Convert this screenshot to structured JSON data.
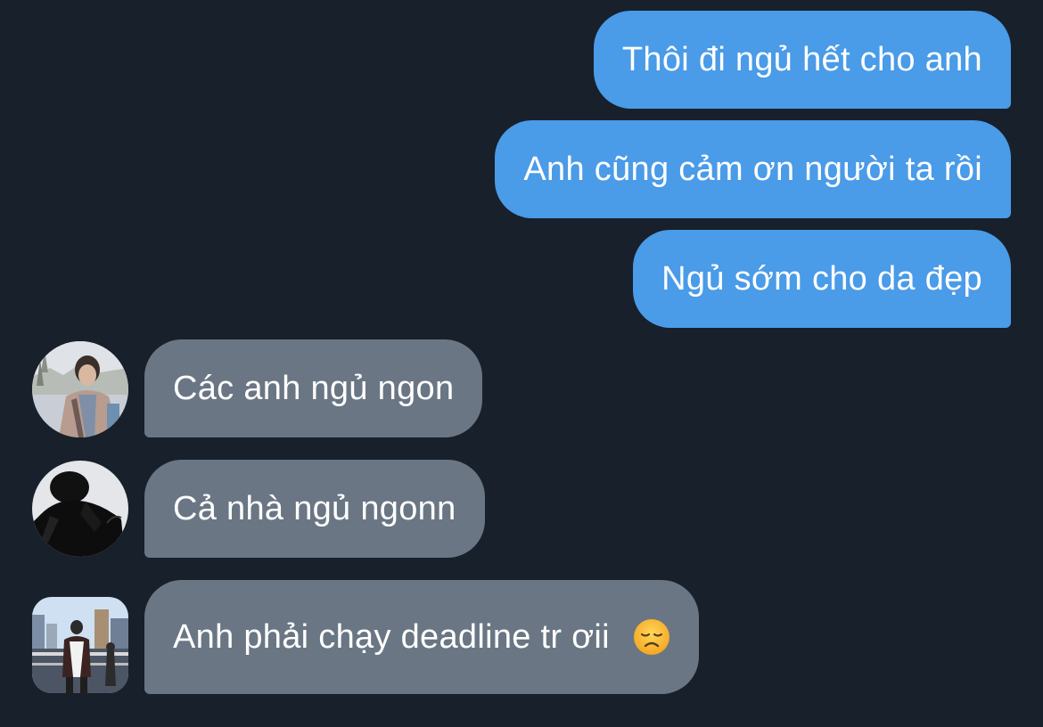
{
  "messages": {
    "outgoing": [
      {
        "text": "Thôi đi ngủ hết cho anh"
      },
      {
        "text": "Anh cũng cảm ơn người ta rồi"
      },
      {
        "text": "Ngủ sớm cho da đẹp"
      }
    ],
    "incoming": [
      {
        "text": "Các anh ngủ ngon",
        "avatar": "avatar-person-outdoor"
      },
      {
        "text": "Cả nhà ngủ ngonn",
        "avatar": "avatar-person-shadow"
      },
      {
        "text": "Anh phải chạy deadline tr ơii",
        "avatar": "avatar-person-city",
        "emoji": "disappointed-face-emoji"
      }
    ]
  },
  "colors": {
    "background": "#18202b",
    "outgoing_bubble": "#4a9be8",
    "incoming_bubble": "#6a7684",
    "text": "#ffffff"
  }
}
